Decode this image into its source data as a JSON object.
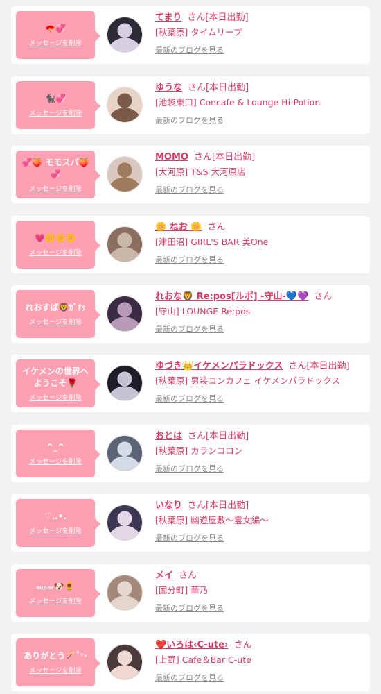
{
  "delete_label": "メッセージを削除",
  "blog_label": "最新のブログを見る",
  "colors": {
    "accent": "#d63c63",
    "bubble": "#ffa0b2",
    "muted": "#8a8a8a"
  },
  "items": [
    {
      "message": "🪭💞",
      "name": "てまり",
      "honorific": "さん",
      "status": "[本日出勤]",
      "shop": "[秋葉原] タイムリープ",
      "avatar_color": "#2d2a38",
      "avatar_light": "#d8cfe0"
    },
    {
      "message": "🐈‍⬛💞",
      "name": "ゆうな",
      "honorific": "さん",
      "status": "[本日出勤]",
      "shop": "[池袋東口] Concafe & Lounge Hi-Potion",
      "avatar_color": "#e8d4c4",
      "avatar_light": "#7a5a48"
    },
    {
      "message": "💞🍑 モモスパ🍑💞",
      "name": "MOMO",
      "honorific": "さん",
      "status": "[本日出勤]",
      "shop": "[大河原] T&S 大河原店",
      "avatar_color": "#d9c8c0",
      "avatar_light": "#a07a5c"
    },
    {
      "message": "💗🌼🌼🌼",
      "name": "🌼 ねお 🌼",
      "honorific": "さん",
      "status": "",
      "shop": "[津田沼] GIRL'S BAR 美One",
      "avatar_color": "#8a6f60",
      "avatar_light": "#c9b8a8"
    },
    {
      "message": "れおすば🦁ｶﾞｵｯ",
      "name": "れおな🦁 Re:pos[ルポ] -守山-💙💜",
      "honorific": "さん",
      "status": "",
      "shop": "[守山] LOUNGE Re:pos",
      "avatar_color": "#3a2a44",
      "avatar_light": "#b79ab8"
    },
    {
      "message": "イケメンの世界へようこそ🌹",
      "name": "ゆづき👑イケメンパラドックス",
      "honorific": "さん",
      "status": "[本日出勤]",
      "shop": "[秋葉原] 男装コンカフェ イケメンパラドックス",
      "avatar_color": "#1e1e28",
      "avatar_light": "#c6c2d4"
    },
    {
      "message": "^_^",
      "name": "おとは",
      "honorific": "さん",
      "status": "[本日出勤]",
      "shop": "[秋葉原] カランコロン",
      "avatar_color": "#5c6578",
      "avatar_light": "#d4dbe6"
    },
    {
      "message": "♡..•.",
      "name": "いなり",
      "honorific": "さん",
      "status": "[本日出勤]",
      "shop": "[秋葉原] 幽遊屋敷～霊女編～",
      "avatar_color": "#3c3650",
      "avatar_light": "#e3d6e6"
    },
    {
      "message": "ₛᵤₚₑᵣ🐶🌻",
      "name": "メイ",
      "honorific": "さん",
      "status": "",
      "shop": "[国分町] 華乃",
      "avatar_color": "#a4897a",
      "avatar_light": "#e4d6cc"
    },
    {
      "message": "ありがとう🪄˚⁺‧",
      "name": "❤️いろは‹C-ute›",
      "honorific": "さん",
      "status": "",
      "shop": "[上野] Cafe＆Bar C-ute",
      "avatar_color": "#4a3a3a",
      "avatar_light": "#efd9d2"
    }
  ]
}
